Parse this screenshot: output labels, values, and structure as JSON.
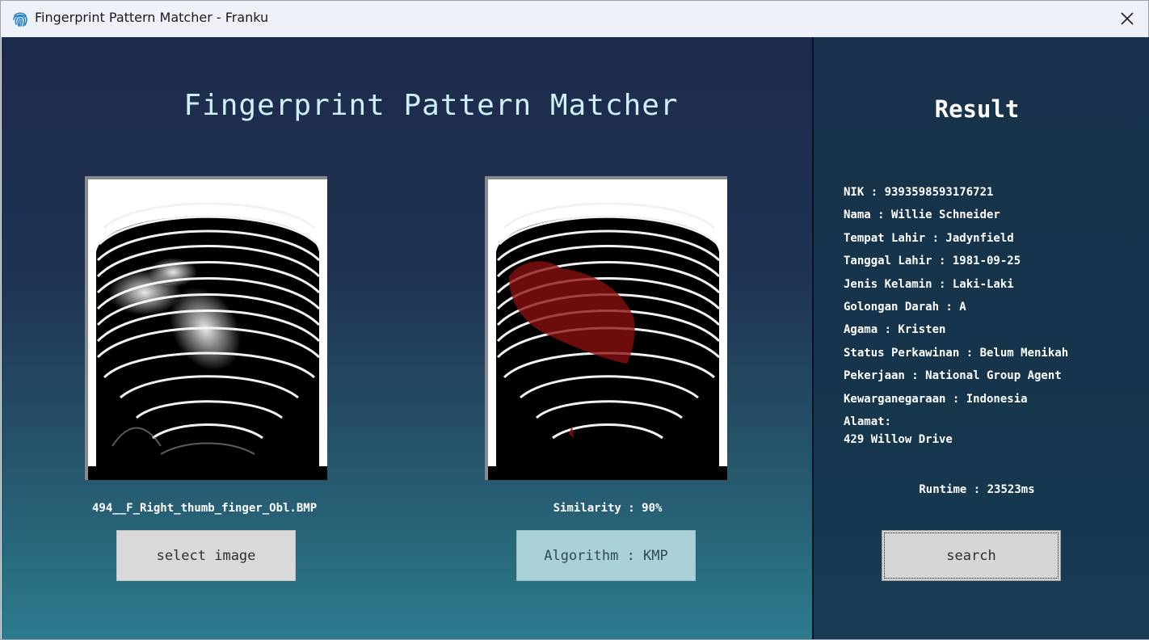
{
  "window": {
    "title": "Fingerprint Pattern Matcher - Franku",
    "icon": "fingerprint-icon",
    "close_icon": "close-icon"
  },
  "main": {
    "title": "Fingerprint Pattern Matcher",
    "input_image": {
      "filename": "494__F_Right_thumb_finger_Obl.BMP"
    },
    "matched_image": {
      "similarity_text": "Similarity : 90%"
    },
    "select_button_label": "select image",
    "algorithm_button_label": "Algorithm : KMP"
  },
  "result": {
    "title": "Result",
    "fields": [
      "NIK : 9393598593176721",
      "Nama : Willie Schneider",
      "Tempat Lahir : Jadynfield",
      "Tanggal Lahir : 1981-09-25",
      "Jenis Kelamin : Laki-Laki",
      "Golongan Darah : A",
      "Agama : Kristen",
      "Status Perkawinan : Belum Menikah",
      "Pekerjaan : National Group Agent",
      "Kewarganegaraan : Indonesia"
    ],
    "address_label": "Alamat:",
    "address_value": "429 Willow Drive",
    "runtime_text": "Runtime : 23523ms",
    "search_button_label": "search"
  },
  "colors": {
    "title_text": "#cdf0f5",
    "algorithm_button": "#a9d1d6",
    "highlight_region": "#8b1010"
  }
}
